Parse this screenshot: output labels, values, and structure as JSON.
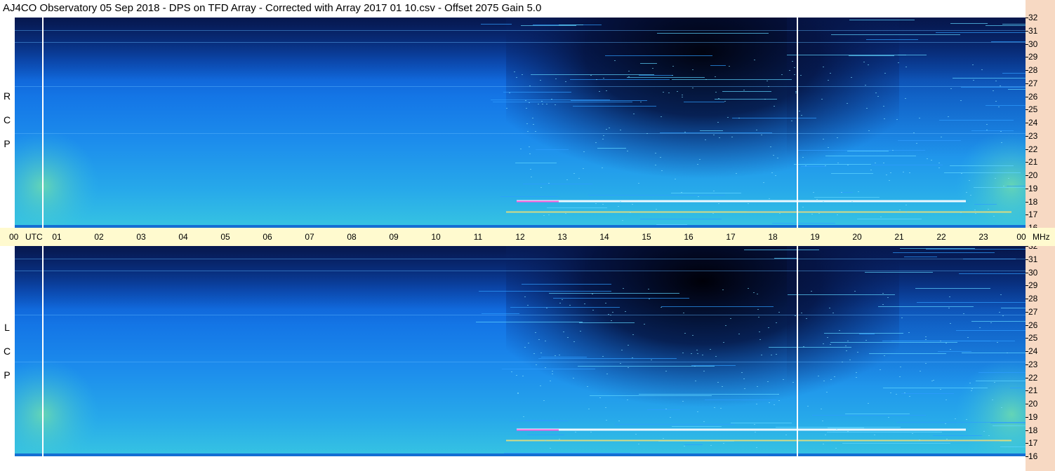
{
  "title": "AJ4CO Observatory  05 Sep 2018  -  DPS on TFD Array  -  Corrected with Array 2017 01 10.csv  -  Offset 2075  Gain 5.0",
  "chart_data": {
    "type": "heatmap",
    "x": {
      "label": "UTC",
      "ticks": [
        "00",
        "01",
        "02",
        "03",
        "04",
        "05",
        "06",
        "07",
        "08",
        "09",
        "10",
        "11",
        "12",
        "13",
        "14",
        "15",
        "16",
        "17",
        "18",
        "19",
        "20",
        "21",
        "22",
        "23",
        "00"
      ],
      "range": [
        0,
        24
      ]
    },
    "y": {
      "label": "MHz",
      "ticks": [
        "16",
        "17",
        "18",
        "19",
        "20",
        "21",
        "22",
        "23",
        "24",
        "25",
        "26",
        "27",
        "28",
        "29",
        "30",
        "31",
        "32"
      ],
      "range": [
        16,
        32
      ]
    },
    "panels": [
      {
        "label": "R C P",
        "polarization": "RCP"
      },
      {
        "label": "L C P",
        "polarization": "LCP"
      }
    ],
    "markers_utc": [
      0.67,
      18.58
    ],
    "colors": {
      "low": "#000010",
      "mid": "#1476e6",
      "high": "#36c4e2",
      "hot": "#ffffff",
      "background_right": "#f7d9c3",
      "time_bar": "#fffacf"
    }
  }
}
